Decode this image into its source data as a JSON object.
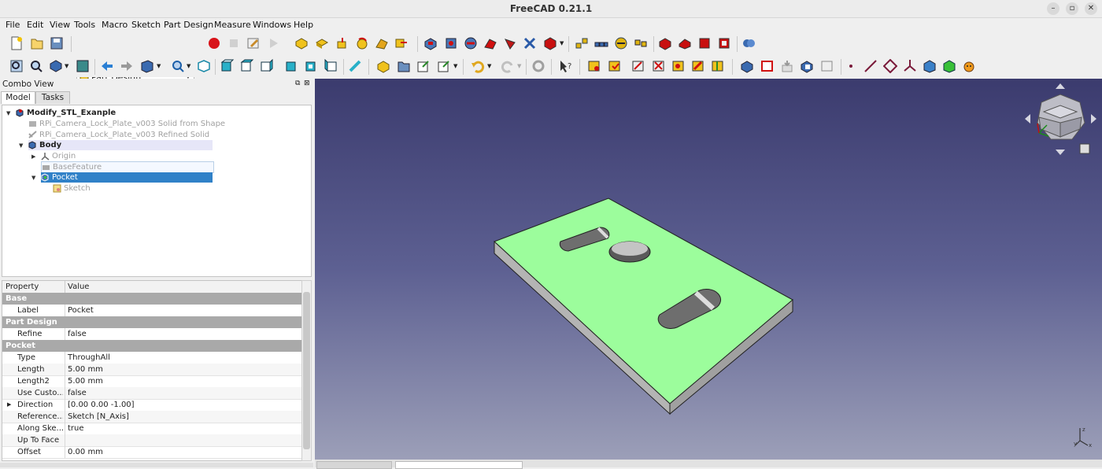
{
  "window": {
    "title": "FreeCAD 0.21.1"
  },
  "menu": [
    "File",
    "Edit",
    "View",
    "Tools",
    "Macro",
    "Sketch",
    "Part Design",
    "Measure",
    "Windows",
    "Help"
  ],
  "toolbar": {
    "workbench": "Part Design"
  },
  "combo": {
    "title": "Combo View",
    "tabs": [
      "Model",
      "Tasks"
    ],
    "tree": [
      {
        "label": "Modify_STL_Exanple",
        "level": 0,
        "style": "bold"
      },
      {
        "label": "RPi_Camera_Lock_Plate_v003 Solid from Shape",
        "level": 1,
        "style": "dim"
      },
      {
        "label": "RPi_Camera_Lock_Plate_v003 Refined Solid",
        "level": 1,
        "style": "dim"
      },
      {
        "label": "Body",
        "level": 1,
        "style": "bold"
      },
      {
        "label": "Origin",
        "level": 2,
        "style": "dim"
      },
      {
        "label": "BaseFeature",
        "level": 2,
        "style": "dim"
      },
      {
        "label": "Pocket",
        "level": 2,
        "style": "selected"
      },
      {
        "label": "Sketch",
        "level": 3,
        "style": "dim"
      }
    ]
  },
  "properties": {
    "header": {
      "property": "Property",
      "value": "Value"
    },
    "rows": [
      {
        "group": "Base"
      },
      {
        "key": "Label",
        "value": "Pocket"
      },
      {
        "group": "Part Design"
      },
      {
        "key": "Refine",
        "value": "false"
      },
      {
        "group": "Pocket"
      },
      {
        "key": "Type",
        "value": "ThroughAll"
      },
      {
        "key": "Length",
        "value": "5.00 mm"
      },
      {
        "key": "Length2",
        "value": "5.00 mm"
      },
      {
        "key": "Use Custo...",
        "value": "false"
      },
      {
        "key": "Direction",
        "value": "[0.00 0.00 -1.00]",
        "expand": true
      },
      {
        "key": "Reference...",
        "value": "Sketch [N_Axis]"
      },
      {
        "key": "Along Ske...",
        "value": "true"
      },
      {
        "key": "Up To Face",
        "value": ""
      },
      {
        "key": "Offset",
        "value": "0.00 mm"
      }
    ]
  },
  "colors": {
    "plate_top": "#9cfd9c",
    "plate_side": "#a0a0a0",
    "selection": "#3081c8"
  }
}
